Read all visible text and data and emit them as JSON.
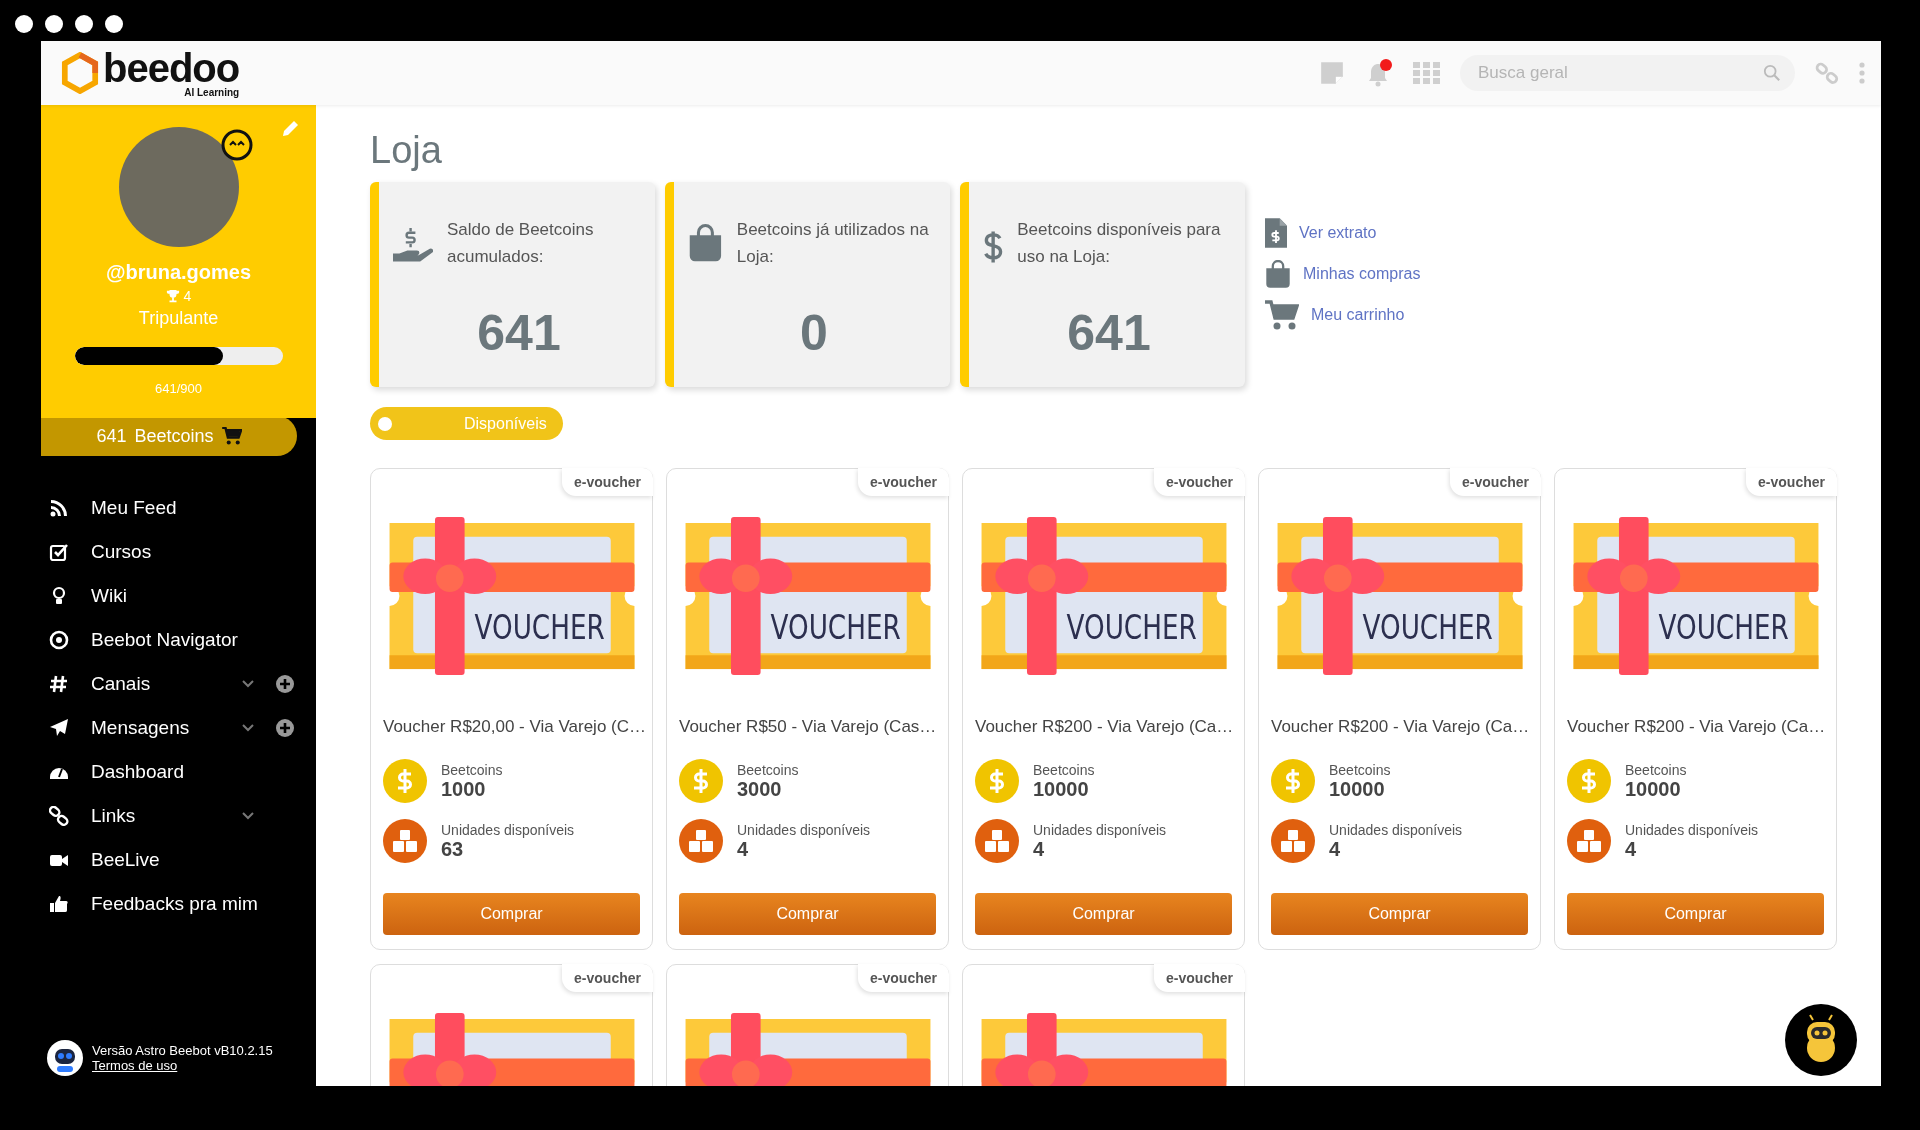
{
  "logo": {
    "name": "beedoo",
    "tagline": "AI Learning"
  },
  "topbar": {
    "notifications": {
      "unread": true
    },
    "search": {
      "placeholder": "Busca geral"
    }
  },
  "profile": {
    "username": "@bruna.gomes",
    "trophies": "4",
    "role": "Tripulante",
    "progress": {
      "level": 0.712,
      "reading": "641/900"
    },
    "beetcoins": {
      "amount": "641",
      "label": "Beetcoins"
    }
  },
  "menu": [
    {
      "label": "Meu Feed",
      "expandable": false,
      "addable": false
    },
    {
      "label": "Cursos",
      "expandable": false,
      "addable": false
    },
    {
      "label": "Wiki",
      "expandable": false,
      "addable": false
    },
    {
      "label": "Beebot Navigator",
      "expandable": false,
      "addable": false
    },
    {
      "label": "Canais",
      "expandable": true,
      "addable": true
    },
    {
      "label": "Mensagens",
      "expandable": true,
      "addable": true
    },
    {
      "label": "Dashboard",
      "expandable": false,
      "addable": false
    },
    {
      "label": "Links",
      "expandable": true,
      "addable": false
    },
    {
      "label": "BeeLive",
      "expandable": false,
      "addable": false
    },
    {
      "label": "Feedbacks pra mim",
      "expandable": false,
      "addable": false
    }
  ],
  "footer": {
    "version": "Versão Astro Beebot vB10.2.15",
    "terms_link": "Termos de uso"
  },
  "page_title": "Loja",
  "stats": [
    {
      "label": "Saldo de Beetcoins acumulados:",
      "value": "641"
    },
    {
      "label": "Beetcoins já utilizados na Loja:",
      "value": "0"
    },
    {
      "label": "Beetcoins disponíveis para uso na Loja:",
      "value": "641"
    }
  ],
  "quick_links": [
    {
      "label": "Ver extrato"
    },
    {
      "label": "Minhas compras"
    },
    {
      "label": "Meu carrinho"
    }
  ],
  "filter": {
    "label": "Disponíveis",
    "on": true
  },
  "products": [
    {
      "badge": "e-voucher",
      "art_text": "VOUCHER",
      "name": "Voucher R$20,00 - Via Varejo (C…",
      "price_label": "Beetcoins",
      "price": "1000",
      "stock_label": "Unidades disponíveis",
      "stock": "63",
      "button": "Comprar"
    },
    {
      "badge": "e-voucher",
      "art_text": "VOUCHER",
      "name": "Voucher R$50 - Via Varejo (Cas…",
      "price_label": "Beetcoins",
      "price": "3000",
      "stock_label": "Unidades disponíveis",
      "stock": "4",
      "button": "Comprar"
    },
    {
      "badge": "e-voucher",
      "art_text": "VOUCHER",
      "name": "Voucher R$200 - Via Varejo (Ca…",
      "price_label": "Beetcoins",
      "price": "10000",
      "stock_label": "Unidades disponíveis",
      "stock": "4",
      "button": "Comprar"
    },
    {
      "badge": "e-voucher",
      "art_text": "VOUCHER",
      "name": "Voucher R$200 - Via Varejo (Ca…",
      "price_label": "Beetcoins",
      "price": "10000",
      "stock_label": "Unidades disponíveis",
      "stock": "4",
      "button": "Comprar"
    },
    {
      "badge": "e-voucher",
      "art_text": "VOUCHER",
      "name": "Voucher R$200 - Via Varejo (Ca…",
      "price_label": "Beetcoins",
      "price": "10000",
      "stock_label": "Unidades disponíveis",
      "stock": "4",
      "button": "Comprar"
    },
    {
      "badge": "e-voucher"
    },
    {
      "badge": "e-voucher"
    },
    {
      "badge": "e-voucher"
    }
  ]
}
